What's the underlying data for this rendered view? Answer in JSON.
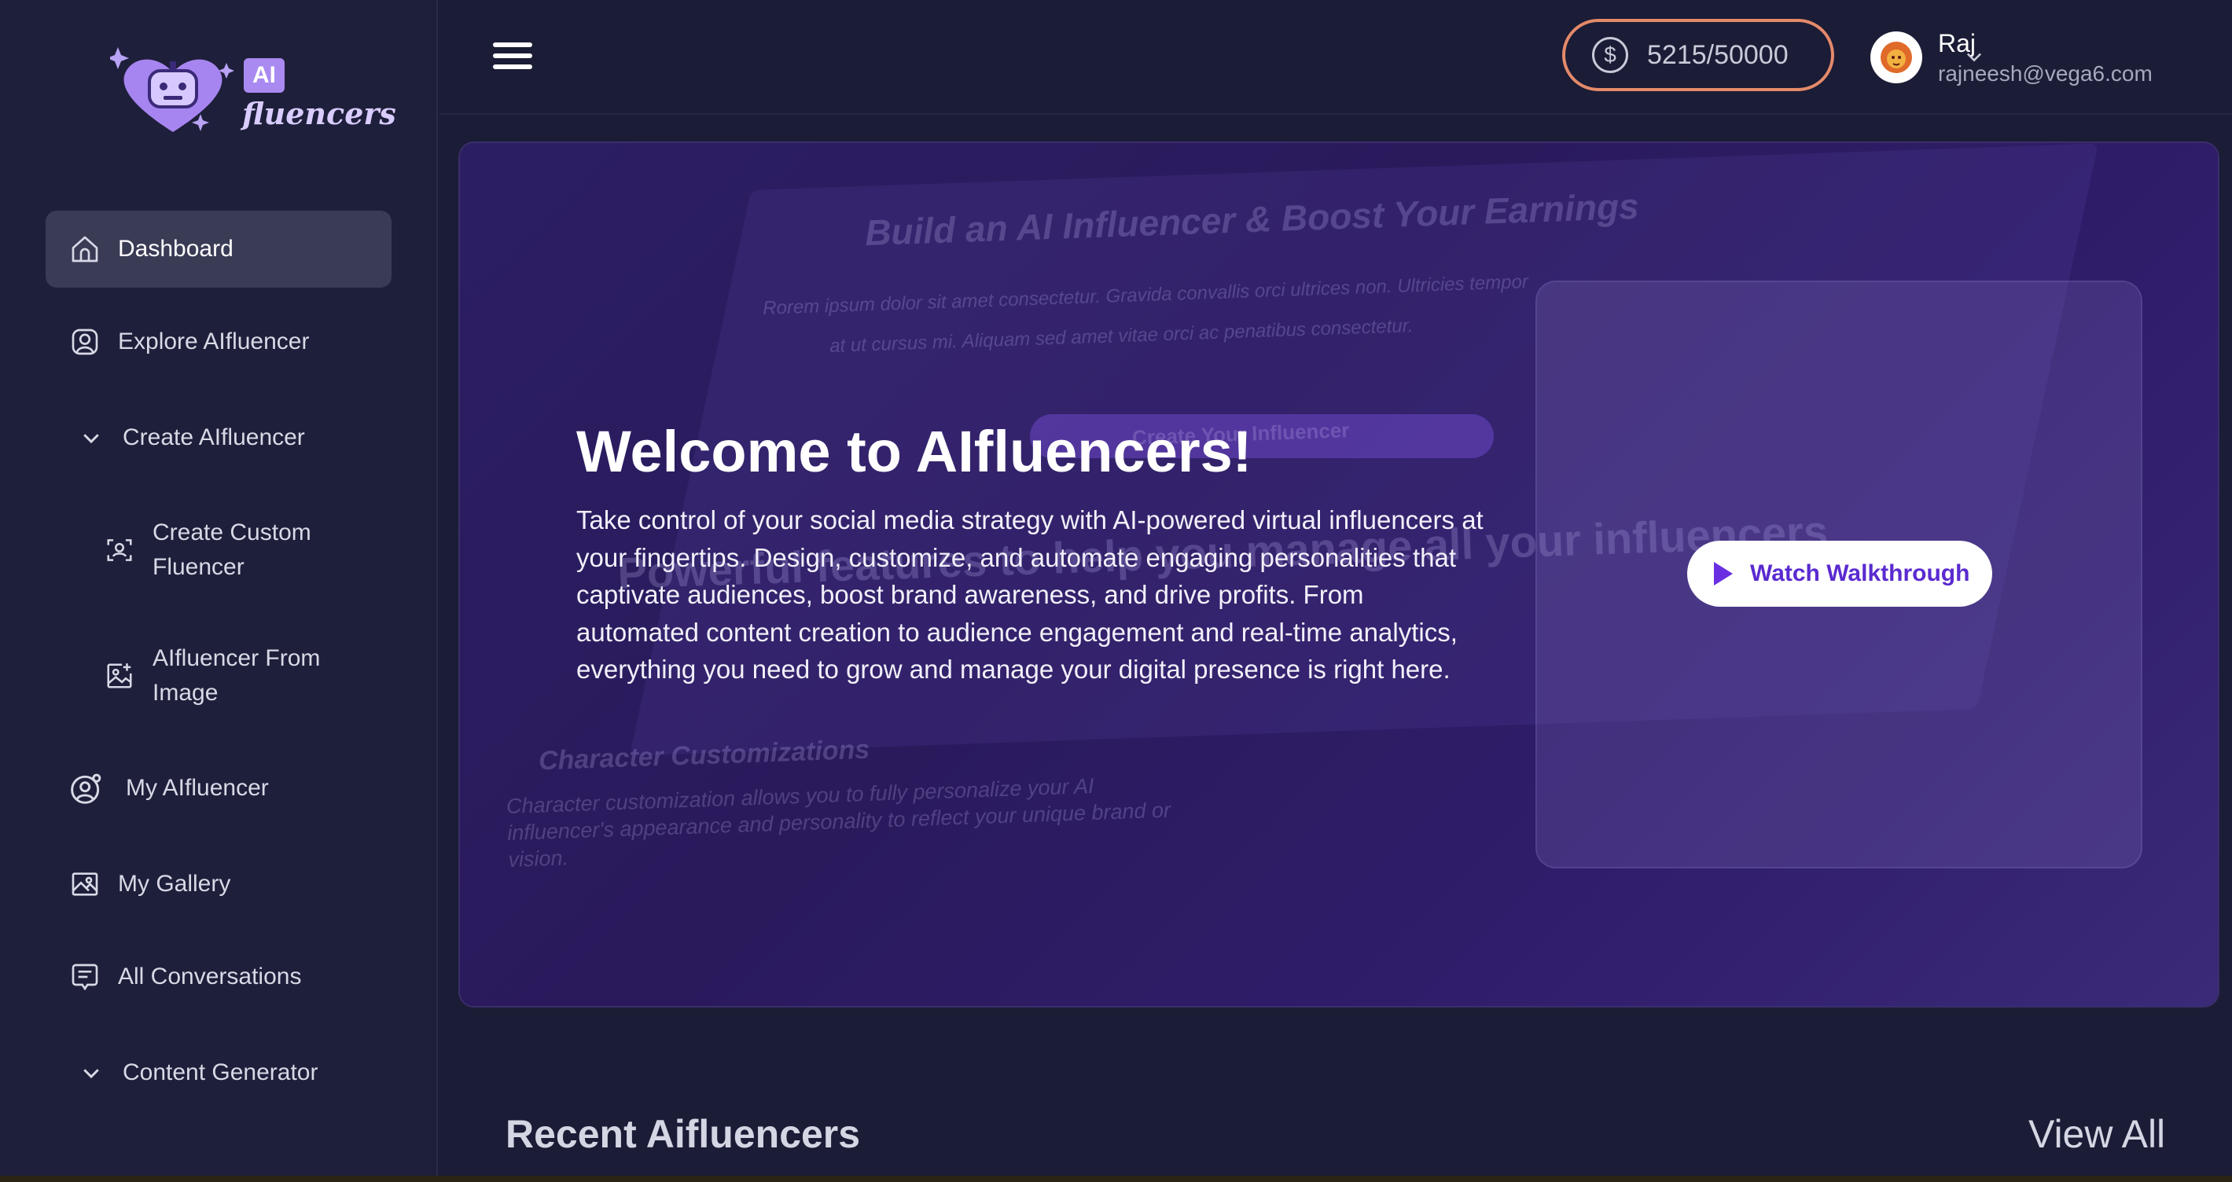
{
  "brand": {
    "logo_badge": "AI",
    "logo_word": "fluencers"
  },
  "sidebar": {
    "items": [
      {
        "label": "Dashboard",
        "icon": "home-icon",
        "active": true
      },
      {
        "label": "Explore AIfluencer",
        "icon": "user-square-icon"
      },
      {
        "label": "Create AIfluencer",
        "icon": "chevron-down-icon"
      },
      {
        "label": "Create Custom Fluencer",
        "icon": "face-scan-icon"
      },
      {
        "label": "AIfluencer From Image",
        "icon": "image-plus-icon"
      },
      {
        "label": "My AIfluencer",
        "icon": "user-gear-icon"
      },
      {
        "label": "My Gallery",
        "icon": "gallery-icon"
      },
      {
        "label": "All Conversations",
        "icon": "chat-icon"
      },
      {
        "label": "Content Generator",
        "icon": "chevron-down-icon"
      }
    ]
  },
  "topbar": {
    "credits": "5215/50000",
    "credit_icon": "$",
    "user_name": "Raj",
    "user_email": "rajneesh@vega6.com"
  },
  "hero": {
    "bg_heading": "Build an AI Influencer & Boost Your Earnings",
    "bg_lorem_1": "Rorem ipsum dolor sit amet consectetur. Gravida convallis orci ultrices non. Ultricies tempor",
    "bg_lorem_2": "at ut cursus mi. Aliquam sed amet vitae orci ac penatibus consectetur.",
    "bg_button": "Create Your Influencer",
    "bg_features": "Powerful features to help you manage all your influencers",
    "bg_custom_title": "Character Customizations",
    "bg_custom_text": "Character customization allows you to fully personalize your AI influencer's appearance and personality to reflect your unique brand or vision.",
    "title": "Welcome to AIfluencers!",
    "description": "Take control of your social media strategy with AI-powered virtual influencers at your fingertips. Design, customize, and automate engaging personalities that captivate audiences, boost brand awareness, and drive profits. From automated content creation to audience engagement and real-time analytics, everything you need to grow and manage your digital presence is right here.",
    "cta": "Watch Walkthrough"
  },
  "recent": {
    "title": "Recent Aifluencers",
    "view_all": "View All"
  },
  "colors": {
    "accent": "#6a2fe0",
    "credits_border": "#e48a6a",
    "sidebar_bg": "#1e1f3a",
    "page_bg": "#1b1c36"
  }
}
